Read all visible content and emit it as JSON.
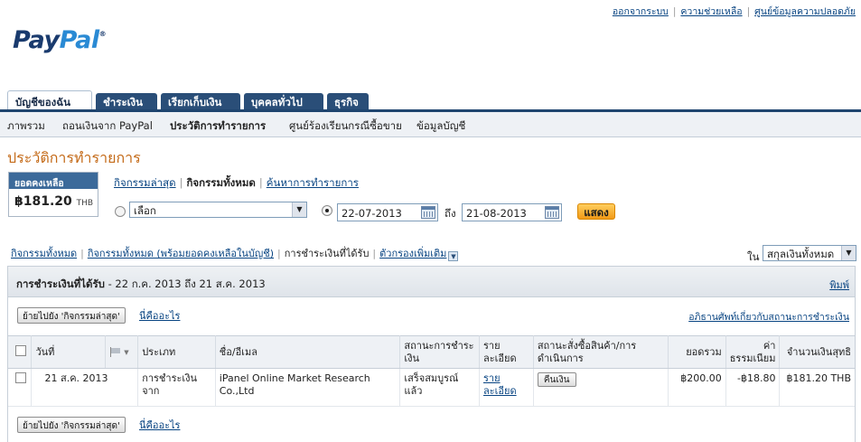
{
  "top_links": [
    "ออกจากระบบ",
    "ความช่วยเหลือ",
    "ศูนย์ข้อมูลความปลอดภัย"
  ],
  "logo": {
    "pay": "Pay",
    "pal": "Pal",
    "mark": "®"
  },
  "tabs": [
    "บัญชีของฉัน",
    "ชำระเงิน",
    "เรียกเก็บเงิน",
    "บุคคลทั่วไป",
    "ธุรกิจ"
  ],
  "subnav": [
    "ภาพรวม",
    "ถอนเงินจาก PayPal",
    "ประวัติการทำรายการ",
    "ศูนย์ร้องเรียนกรณีซื้อขาย",
    "ข้อมูลบัญชี"
  ],
  "page_title": "ประวัติการทำรายการ",
  "balance": {
    "label": "ยอดคงเหลือ",
    "amount": "฿181.20",
    "currency": "THB"
  },
  "filter_links": {
    "recent": "กิจกรรมล่าสุด",
    "all": "กิจกรรมทั้งหมด",
    "search": "ค้นหาการทำรายการ"
  },
  "period_select": {
    "value": "เลือก"
  },
  "date_from": "22-07-2013",
  "date_to_label": "ถึง",
  "date_to": "21-08-2013",
  "show_button": "แสดง",
  "view_links": {
    "all": "กิจกรรมทั้งหมด",
    "all_with_balance": "กิจกรรมทั้งหมด (พร้อมยอดคงเหลือในบัญชี)",
    "payments_received": "การชำระเงินที่ได้รับ",
    "more_filters": "ตัวกรองเพิ่มเติม"
  },
  "currency_filter": {
    "label": "ใน",
    "value": "สกุลเงินทั้งหมด"
  },
  "panel": {
    "title_bold": "การชำระเงินที่ได้รับ",
    "title_range": "- 22 ก.ค. 2013 ถึง 21 ส.ค. 2013",
    "print": "พิมพ์",
    "move_button": "ย้ายไปยัง 'กิจกรรมล่าสุด'",
    "what_is_this": "นี่คืออะไร",
    "glossary": "อภิธานศัพท์เกี่ยวกับสถานะการชำระเงิน"
  },
  "table": {
    "headers": {
      "date": "วันที่",
      "type": "ประเภท",
      "name": "ชื่อ/อีเมล",
      "status": "สถานะการชำระเงิน",
      "details": "รายละเอียด",
      "order_status": "สถานะสั่งซื้อสินค้า/การดำเนินการ",
      "gross": "ยอดรวม",
      "fee": "ค่าธรรมเนียม",
      "net": "จำนวนเงินสุทธิ"
    },
    "rows": [
      {
        "date": "21 ส.ค. 2013",
        "type": "การชำระเงิน จาก",
        "name": "iPanel Online Market Research Co.,Ltd",
        "status": "เสร็จสมบูรณ์แล้ว",
        "details": "รายละเอียด",
        "action": "คืนเงิน",
        "gross": "฿200.00",
        "fee": "-฿18.80",
        "net": "฿181.20 THB"
      }
    ]
  }
}
